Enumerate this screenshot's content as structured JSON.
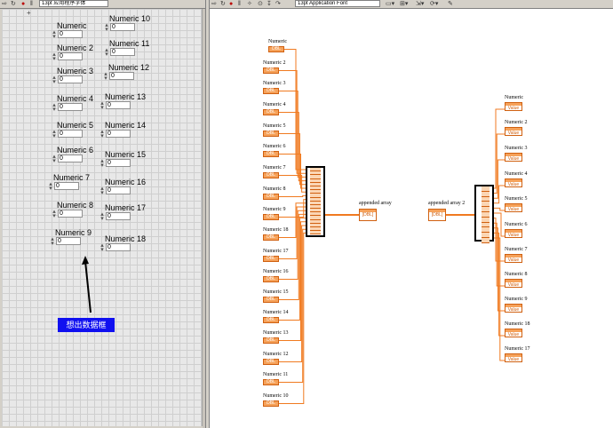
{
  "front_panel": {
    "toolbar": {
      "run_icon": "run-arrow-icon",
      "font_field": "13pt 应用程序字体"
    },
    "controls": [
      {
        "label": "Numeric",
        "value": "0"
      },
      {
        "label": "Numeric 2",
        "value": "0"
      },
      {
        "label": "Numeric 3",
        "value": "0"
      },
      {
        "label": "Numeric 4",
        "value": "0"
      },
      {
        "label": "Numeric 5",
        "value": "0"
      },
      {
        "label": "Numeric 6",
        "value": "0"
      },
      {
        "label": "Numeric 7",
        "value": "0"
      },
      {
        "label": "Numeric 8",
        "value": "0"
      },
      {
        "label": "Numeric 9",
        "value": "0"
      },
      {
        "label": "Numeric 10",
        "value": "0"
      },
      {
        "label": "Numeric 11",
        "value": "0"
      },
      {
        "label": "Numeric 12",
        "value": "0"
      },
      {
        "label": "Numeric 13",
        "value": "0"
      },
      {
        "label": "Numeric 14",
        "value": "0"
      },
      {
        "label": "Numeric 15",
        "value": "0"
      },
      {
        "label": "Numeric 16",
        "value": "0"
      },
      {
        "label": "Numeric 17",
        "value": "0"
      },
      {
        "label": "Numeric 18",
        "value": "0"
      }
    ],
    "annotation": "想出数据框"
  },
  "block_diagram": {
    "toolbar": {
      "font_field": "13pt Application Font"
    },
    "input_terminals": [
      {
        "label": "Numeric",
        "tag": "DBL"
      },
      {
        "label": "Numeric 2",
        "tag": "DBL"
      },
      {
        "label": "Numeric 3",
        "tag": "DBL"
      },
      {
        "label": "Numeric 4",
        "tag": "DBL"
      },
      {
        "label": "Numeric 5",
        "tag": "DBL"
      },
      {
        "label": "Numeric 6",
        "tag": "DBL"
      },
      {
        "label": "Numeric 7",
        "tag": "DBL"
      },
      {
        "label": "Numeric 8",
        "tag": "DBL"
      },
      {
        "label": "Numeric 9",
        "tag": "DBL"
      },
      {
        "label": "Numeric 18",
        "tag": "DBL"
      },
      {
        "label": "Numeric 17",
        "tag": "DBL"
      },
      {
        "label": "Numeric 16",
        "tag": "DBL"
      },
      {
        "label": "Numeric 15",
        "tag": "DBL"
      },
      {
        "label": "Numeric 14",
        "tag": "DBL"
      },
      {
        "label": "Numeric 13",
        "tag": "DBL"
      },
      {
        "label": "Numeric 12",
        "tag": "DBL"
      },
      {
        "label": "Numeric 11",
        "tag": "DBL"
      },
      {
        "label": "Numeric 10",
        "tag": "DBL"
      }
    ],
    "appended_array": "appended array",
    "appended_array_2": "appended array 2",
    "array_tag": "[DBL]",
    "output_terminals": [
      {
        "label": "Numeric",
        "tag": "Value"
      },
      {
        "label": "Numeric 2",
        "tag": "Value"
      },
      {
        "label": "Numeric 3",
        "tag": "Value"
      },
      {
        "label": "Numeric 4",
        "tag": "Value"
      },
      {
        "label": "Numeric 5",
        "tag": "Value"
      },
      {
        "label": "Numeric 6",
        "tag": "Value"
      },
      {
        "label": "Numeric 7",
        "tag": "Value"
      },
      {
        "label": "Numeric 8",
        "tag": "Value"
      },
      {
        "label": "Numeric 9",
        "tag": "Value"
      },
      {
        "label": "Numeric 18",
        "tag": "Value"
      },
      {
        "label": "Numeric 17",
        "tag": "Value"
      }
    ],
    "colors": {
      "wire": "#f07a20",
      "terminal": "#f6a25a"
    }
  }
}
